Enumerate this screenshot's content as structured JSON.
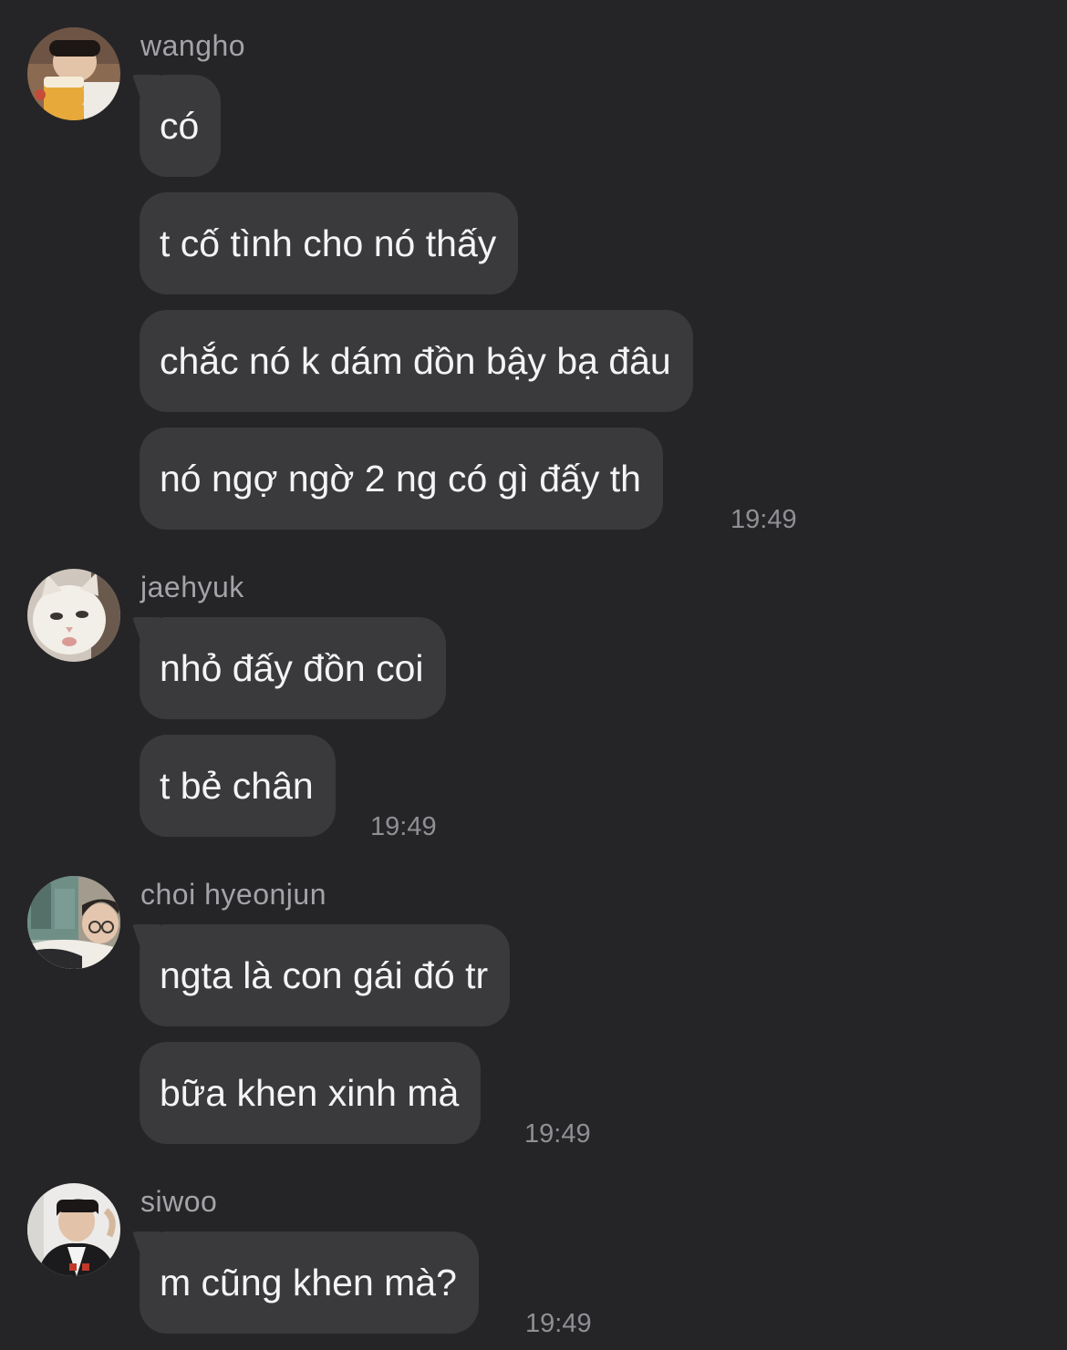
{
  "conversation": [
    {
      "sender": "wangho",
      "avatar": "avatar-wangho",
      "messages": [
        "có",
        "t cố tình cho nó thấy",
        "chắc nó k dám đồn bậy bạ đâu",
        "nó ngợ ngờ 2 ng có gì đấy th"
      ],
      "time": "19:49"
    },
    {
      "sender": "jaehyuk",
      "avatar": "avatar-jaehyuk",
      "messages": [
        "nhỏ đấy đồn coi",
        "t bẻ chân"
      ],
      "time": "19:49"
    },
    {
      "sender": "choi hyeonjun",
      "avatar": "avatar-choi-hyeonjun",
      "messages": [
        "ngta là con gái đó tr",
        "bữa khen xinh mà"
      ],
      "time": "19:49"
    },
    {
      "sender": "siwoo",
      "avatar": "avatar-siwoo",
      "messages": [
        "m cũng khen mà?"
      ],
      "time": "19:49"
    }
  ],
  "colors": {
    "background": "#252527",
    "bubble": "#3a3a3c",
    "sender": "#a3a3a8",
    "timestamp": "#8f8f94"
  }
}
